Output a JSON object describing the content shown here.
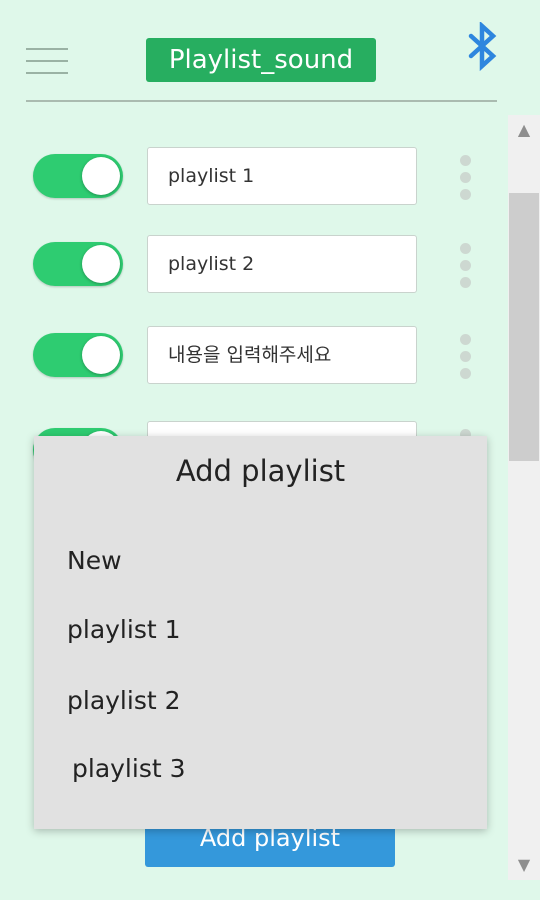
{
  "header": {
    "title": "Playlist_sound",
    "menu_icon": "hamburger-menu-icon",
    "bluetooth_icon": "bluetooth-icon",
    "accent_color": "#27ae60"
  },
  "rows": [
    {
      "toggle_on": true,
      "value": "playlist 1",
      "placeholder": ""
    },
    {
      "toggle_on": true,
      "value": "playlist 2",
      "placeholder": ""
    },
    {
      "toggle_on": true,
      "value": "",
      "placeholder": "내용을 입력해주세요"
    },
    {
      "toggle_on": true,
      "value": "",
      "placeholder": ""
    }
  ],
  "add_button": {
    "label": "Add playlist",
    "color": "#3498db"
  },
  "dialog": {
    "title": "Add playlist",
    "options": [
      "New",
      "playlist 1",
      "playlist 2",
      "playlist 3"
    ]
  },
  "scrollbar": {
    "up_icon": "scroll-up-arrow-icon",
    "down_icon": "scroll-down-arrow-icon"
  }
}
